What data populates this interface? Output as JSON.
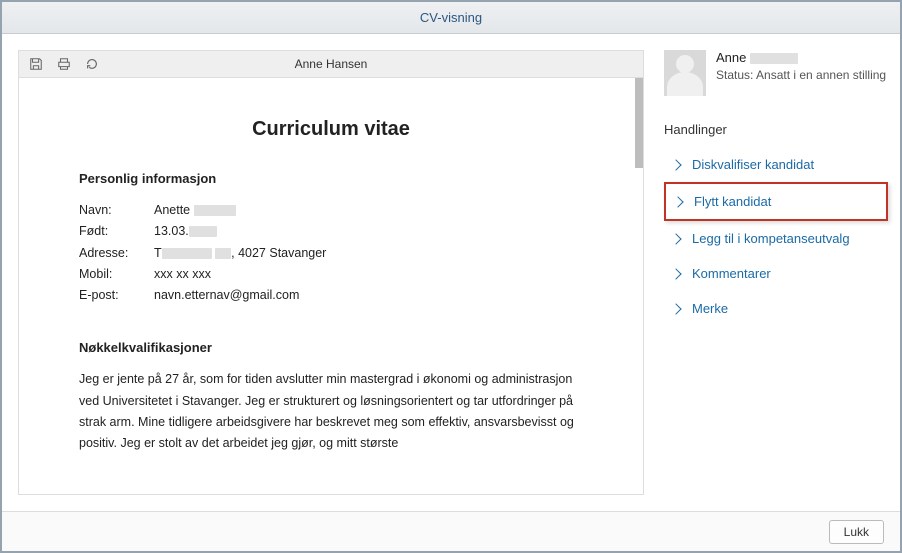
{
  "window": {
    "title": "CV-visning"
  },
  "toolbar": {
    "doc_name": "Anne Hansen"
  },
  "cv": {
    "heading": "Curriculum vitae",
    "section_personal": "Personlig informasjon",
    "labels": {
      "name": "Navn:",
      "born": "Født:",
      "address": "Adresse:",
      "mobile": "Mobil:",
      "email": "E-post:"
    },
    "values": {
      "name_prefix": "Anette",
      "born_prefix": "13.03.",
      "address_prefix": "T",
      "address_suffix": ", 4027 Stavanger",
      "mobile": "xxx xx xxx",
      "email": "navn.etternav@gmail.com"
    },
    "section_keyqual": "Nøkkelkvalifikasjoner",
    "keyqual_text": "Jeg er jente på 27 år, som for tiden avslutter min mastergrad i økonomi og administrasjon ved Universitetet i Stavanger. Jeg er strukturert og løsningsorientert og tar utfordringer på strak arm. Mine tidligere arbeidsgivere har beskrevet meg som effektiv, ansvarsbevisst og positiv. Jeg er stolt av det arbeidet jeg gjør, og mitt største"
  },
  "sidebar": {
    "name_prefix": "Anne",
    "status": "Status: Ansatt i en annen stilling",
    "actions_heading": "Handlinger",
    "actions": [
      {
        "label": "Diskvalifiser kandidat"
      },
      {
        "label": "Flytt kandidat"
      },
      {
        "label": "Legg til i kompetanseutvalg"
      },
      {
        "label": "Kommentarer"
      },
      {
        "label": "Merke"
      }
    ]
  },
  "footer": {
    "close": "Lukk"
  }
}
